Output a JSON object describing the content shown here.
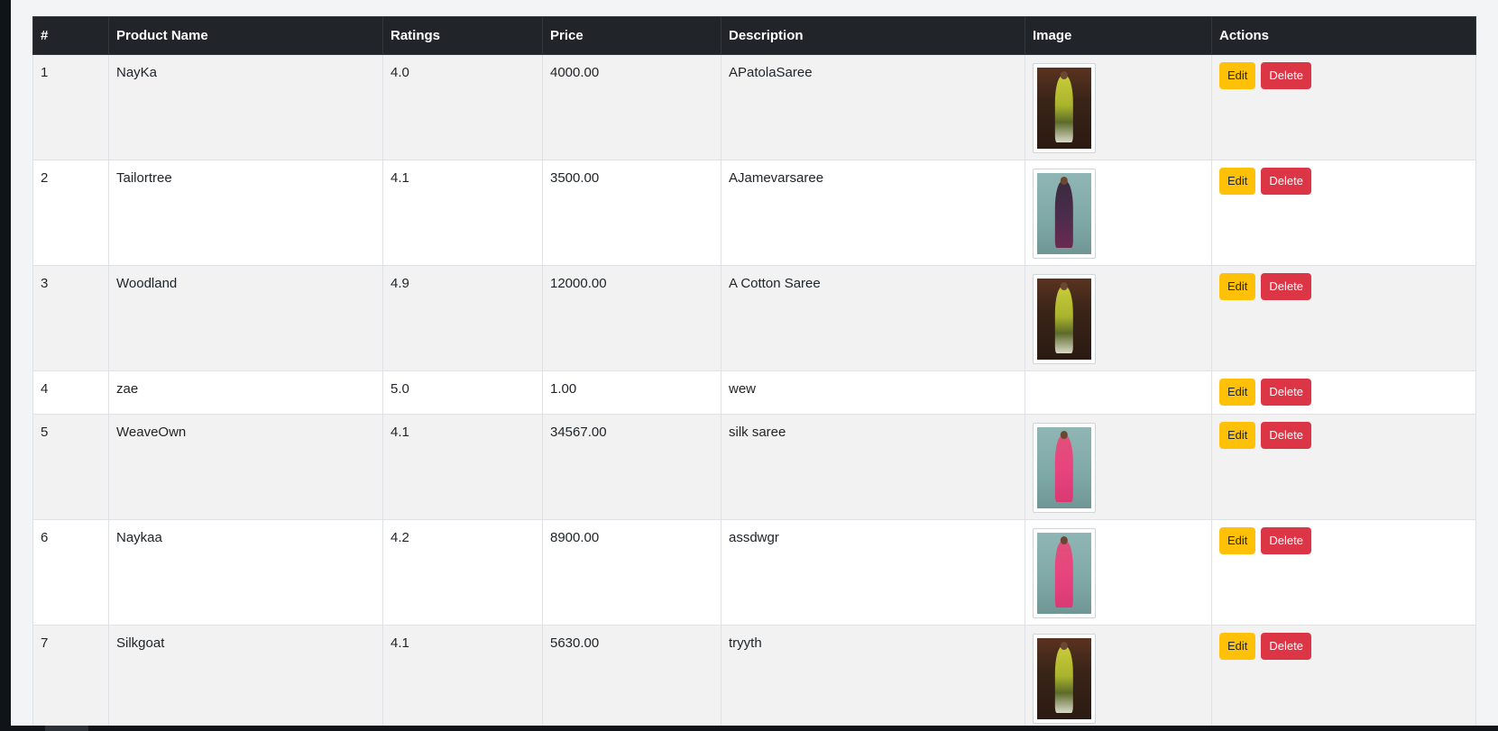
{
  "table": {
    "headers": [
      "#",
      "Product Name",
      "Ratings",
      "Price",
      "Description",
      "Image",
      "Actions"
    ],
    "actions": {
      "edit_label": "Edit",
      "delete_label": "Delete"
    },
    "rows": [
      {
        "id": "1",
        "name": "NayKa",
        "rating": "4.0",
        "price": "4000.00",
        "description": "APatolaSaree",
        "image": "saree-yellow"
      },
      {
        "id": "2",
        "name": "Tailortree",
        "rating": "4.1",
        "price": "3500.00",
        "description": "AJamevarsaree",
        "image": "saree-purple"
      },
      {
        "id": "3",
        "name": "Woodland",
        "rating": "4.9",
        "price": "12000.00",
        "description": "A Cotton Saree",
        "image": "saree-yellow"
      },
      {
        "id": "4",
        "name": "zae",
        "rating": "5.0",
        "price": "1.00",
        "description": "wew",
        "image": ""
      },
      {
        "id": "5",
        "name": "WeaveOwn",
        "rating": "4.1",
        "price": "34567.00",
        "description": "silk saree",
        "image": "saree-pink"
      },
      {
        "id": "6",
        "name": "Naykaa",
        "rating": "4.2",
        "price": "8900.00",
        "description": "assdwgr",
        "image": "saree-pink"
      },
      {
        "id": "7",
        "name": "Silkgoat",
        "rating": "4.1",
        "price": "5630.00",
        "description": "tryyth",
        "image": "saree-yellow"
      }
    ]
  }
}
